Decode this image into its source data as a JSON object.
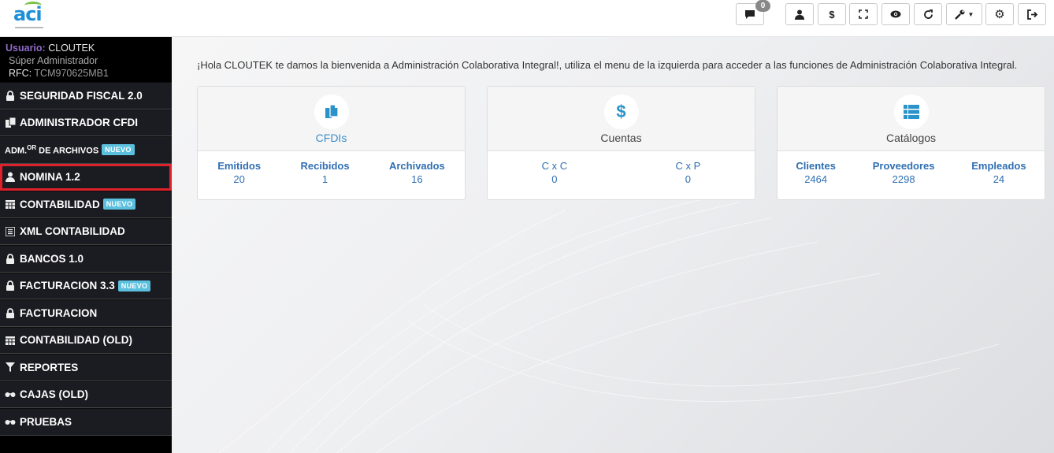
{
  "header": {
    "logo_text": "aci",
    "notifications_count": "0",
    "icons": [
      "comment-icon",
      "user-icon",
      "dollar-icon",
      "fullscreen-icon",
      "eye-icon",
      "refresh-icon",
      "wrench-icon",
      "gear-icon",
      "logout-icon"
    ]
  },
  "user": {
    "label": "Usuario:",
    "name": "CLOUTEK",
    "role": "Súper Administrador",
    "rfc_label": "RFC:",
    "rfc": "TCM970625MB1"
  },
  "sidebar": {
    "items": [
      {
        "label": "SEGURIDAD FISCAL 2.0",
        "icon": "lock-icon"
      },
      {
        "label": "ADMINISTRADOR CFDI",
        "icon": "copy-icon"
      },
      {
        "label_a": "ADM.",
        "label_sup": "OR",
        "label_b": " DE ARCHIVOS",
        "icon": "",
        "badge": "NUEVO"
      },
      {
        "label": "NOMINA 1.2",
        "icon": "user-icon"
      },
      {
        "label": "CONTABILIDAD",
        "icon": "calendar-icon",
        "badge": "NUEVO"
      },
      {
        "label": "XML CONTABILIDAD",
        "icon": "list-icon"
      },
      {
        "label": "BANCOS 1.0",
        "icon": "lock-icon"
      },
      {
        "label": "FACTURACION 3.3",
        "icon": "lock-icon",
        "badge": "NUEVO"
      },
      {
        "label": "FACTURACION",
        "icon": "lock-icon"
      },
      {
        "label": "CONTABILIDAD (OLD)",
        "icon": "calendar-icon"
      },
      {
        "label": "REPORTES",
        "icon": "filter-icon"
      },
      {
        "label": "CAJAS (OLD)",
        "icon": "glasses-icon"
      },
      {
        "label": "PRUEBAS",
        "icon": "glasses-icon"
      }
    ]
  },
  "main": {
    "welcome": "¡Hola CLOUTEK te damos la bienvenida a Administración Colaborativa Integral!, utiliza el menu de la izquierda para acceder a las funciones de Administración Colaborativa Integral.",
    "cards": [
      {
        "title": "CFDIs",
        "icon": "files-icon",
        "stats": [
          {
            "label": "Emitidos",
            "value": "20"
          },
          {
            "label": "Recibidos",
            "value": "1"
          },
          {
            "label": "Archivados",
            "value": "16"
          }
        ]
      },
      {
        "title": "Cuentas",
        "icon": "dollar-icon",
        "stats": [
          {
            "label": "C x C",
            "value": "0"
          },
          {
            "label": "C x P",
            "value": "0"
          }
        ]
      },
      {
        "title": "Catálogos",
        "icon": "list-icon",
        "stats": [
          {
            "label": "Clientes",
            "value": "2464"
          },
          {
            "label": "Proveedores",
            "value": "2298"
          },
          {
            "label": "Empleados",
            "value": "24"
          }
        ]
      }
    ]
  },
  "colors": {
    "sidebar_bg": "#1b1b22",
    "accent_blue": "#2b93c9",
    "badge_nuevo": "#5bc0de",
    "highlight_red": "#e0202b",
    "user_label": "#8e6bc7"
  }
}
